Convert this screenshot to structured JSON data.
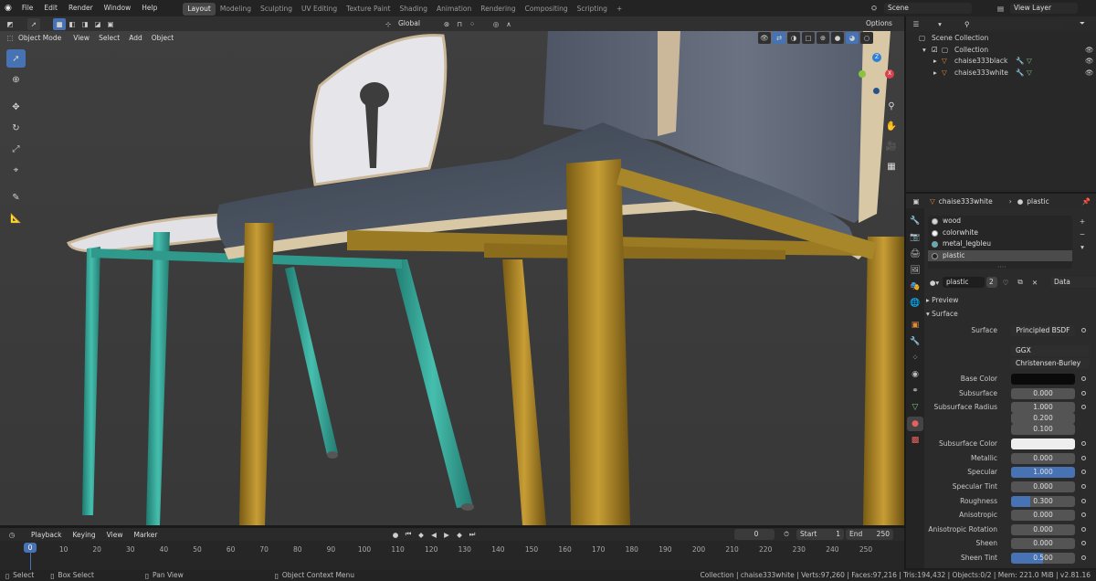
{
  "topbar": {
    "menus": [
      "File",
      "Edit",
      "Render",
      "Window",
      "Help"
    ],
    "workspaces": [
      "Layout",
      "Modeling",
      "Sculpting",
      "UV Editing",
      "Texture Paint",
      "Shading",
      "Animation",
      "Rendering",
      "Compositing",
      "Scripting"
    ],
    "active_workspace": "Layout",
    "add_tab": "+",
    "scene": "Scene",
    "view_layer": "View Layer"
  },
  "toolbar_header": {
    "transform_orientation": "Global",
    "options": "Options"
  },
  "viewport_header": {
    "mode": "Object Mode",
    "menus": [
      "View",
      "Select",
      "Add",
      "Object"
    ]
  },
  "outliner": {
    "rows": [
      {
        "label": "Scene Collection"
      },
      {
        "label": "Collection"
      },
      {
        "label": "chaise333black"
      },
      {
        "label": "chaise333white"
      }
    ]
  },
  "properties": {
    "object": "chaise333white",
    "material": "plastic",
    "slots": [
      "wood",
      "colorwhite",
      "metal_legbleu",
      "plastic"
    ],
    "selected_slot": "plastic",
    "slot_dots": "····",
    "mat_name": "plastic",
    "users": "2",
    "link": "Data",
    "preview": "Preview",
    "surface": "Surface",
    "surface_label": "Surface",
    "surface_shader": "Principled BSDF",
    "distribution": "GGX",
    "sss_method": "Christensen-Burley",
    "params": [
      {
        "label": "Base Color",
        "value": "",
        "kind": "color-black"
      },
      {
        "label": "Subsurface",
        "value": "0.000",
        "kind": "num"
      },
      {
        "label": "Subsurface Radius",
        "value": "1.000",
        "kind": "num"
      },
      {
        "label": "",
        "value": "0.200",
        "kind": "num"
      },
      {
        "label": "",
        "value": "0.100",
        "kind": "num"
      },
      {
        "label": "Subsurface Color",
        "value": "",
        "kind": "color-white"
      },
      {
        "label": "Metallic",
        "value": "0.000",
        "kind": "num"
      },
      {
        "label": "Specular",
        "value": "1.000",
        "kind": "full"
      },
      {
        "label": "Specular Tint",
        "value": "0.000",
        "kind": "num"
      },
      {
        "label": "Roughness",
        "value": "0.300",
        "kind": "num",
        "fill": 0.3
      },
      {
        "label": "Anisotropic",
        "value": "0.000",
        "kind": "num"
      },
      {
        "label": "Anisotropic Rotation",
        "value": "0.000",
        "kind": "num"
      },
      {
        "label": "Sheen",
        "value": "0.000",
        "kind": "num"
      },
      {
        "label": "Sheen Tint",
        "value": "0.500",
        "kind": "num",
        "fill": 0.5
      }
    ]
  },
  "timeline": {
    "menus": [
      "Playback",
      "Keying",
      "View",
      "Marker"
    ],
    "current_frame": "0",
    "start_label": "Start",
    "start": "1",
    "end_label": "End",
    "end": "250",
    "ticks": [
      "0",
      "10",
      "20",
      "30",
      "40",
      "50",
      "60",
      "70",
      "80",
      "90",
      "100",
      "110",
      "120",
      "130",
      "140",
      "150",
      "160",
      "170",
      "180",
      "190",
      "200",
      "210",
      "220",
      "230",
      "240",
      "250"
    ],
    "playhead": "0"
  },
  "statusbar": {
    "select": "Select",
    "box_select": "Box Select",
    "pan_view": "Pan View",
    "context_menu": "Object Context Menu",
    "stats": "Collection | chaise333white | Verts:97,260 | Faces:97,216 | Tris:194,432 | Objects:0/2 | Mem: 221.0 MiB | v2.81.16"
  },
  "colors": {
    "accent": "#4772b3",
    "gold_leg": "#b08a2a",
    "teal_leg": "#3aa89a"
  },
  "gizmo": {
    "x": "X",
    "y": "Y",
    "z": "Z"
  }
}
